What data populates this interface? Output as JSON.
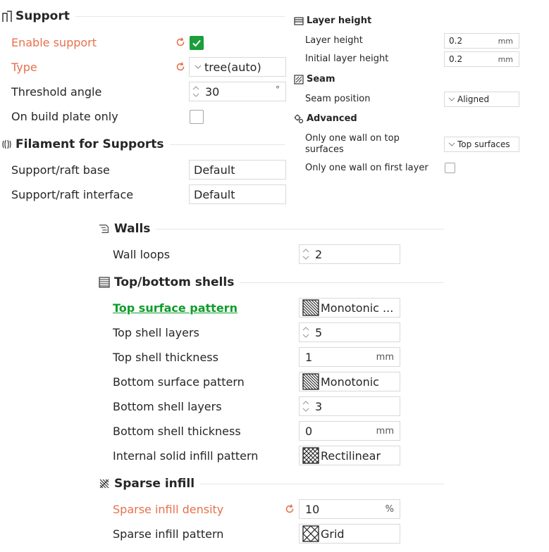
{
  "support": {
    "title": "Support",
    "enable_support": {
      "label": "Enable support",
      "checked": true
    },
    "type": {
      "label": "Type",
      "value": "tree(auto)"
    },
    "threshold_angle": {
      "label": "Threshold angle",
      "value": "30",
      "unit": "°"
    },
    "on_build_plate_only": {
      "label": "On build plate only",
      "checked": false
    }
  },
  "filament_supports": {
    "title": "Filament for Supports",
    "raft_base": {
      "label": "Support/raft base",
      "value": "Default"
    },
    "raft_interface": {
      "label": "Support/raft interface",
      "value": "Default"
    }
  },
  "layer_height": {
    "title": "Layer height",
    "layer_height": {
      "label": "Layer height",
      "value": "0.2",
      "unit": "mm"
    },
    "initial_layer_height": {
      "label": "Initial layer height",
      "value": "0.2",
      "unit": "mm"
    }
  },
  "seam": {
    "title": "Seam",
    "seam_position": {
      "label": "Seam position",
      "value": "Aligned"
    }
  },
  "advanced": {
    "title": "Advanced",
    "one_wall_top": {
      "label_line1": "Only one wall on top",
      "label_line2": "surfaces",
      "value": "Top surfaces"
    },
    "one_wall_first": {
      "label": "Only one wall on first layer",
      "checked": false
    }
  },
  "walls": {
    "title": "Walls",
    "wall_loops": {
      "label": "Wall loops",
      "value": "2"
    }
  },
  "top_bottom": {
    "title": "Top/bottom shells",
    "top_surface_pattern": {
      "label": "Top surface pattern",
      "value": "Monotonic ..."
    },
    "top_shell_layers": {
      "label": "Top shell layers",
      "value": "5"
    },
    "top_shell_thickness": {
      "label": "Top shell thickness",
      "value": "1",
      "unit": "mm"
    },
    "bottom_surface_pattern": {
      "label": "Bottom surface pattern",
      "value": "Monotonic"
    },
    "bottom_shell_layers": {
      "label": "Bottom shell layers",
      "value": "3"
    },
    "bottom_shell_thickness": {
      "label": "Bottom shell thickness",
      "value": "0",
      "unit": "mm"
    },
    "internal_solid_infill_pattern": {
      "label": "Internal solid infill pattern",
      "value": "Rectilinear"
    }
  },
  "sparse_infill": {
    "title": "Sparse infill",
    "density": {
      "label": "Sparse infill density",
      "value": "10",
      "unit": "%"
    },
    "pattern": {
      "label": "Sparse infill pattern",
      "value": "Grid"
    }
  },
  "colors": {
    "modified_label": "#e8704c",
    "link_label": "#0f9d2b",
    "checkbox_on": "#1a9f3a"
  }
}
